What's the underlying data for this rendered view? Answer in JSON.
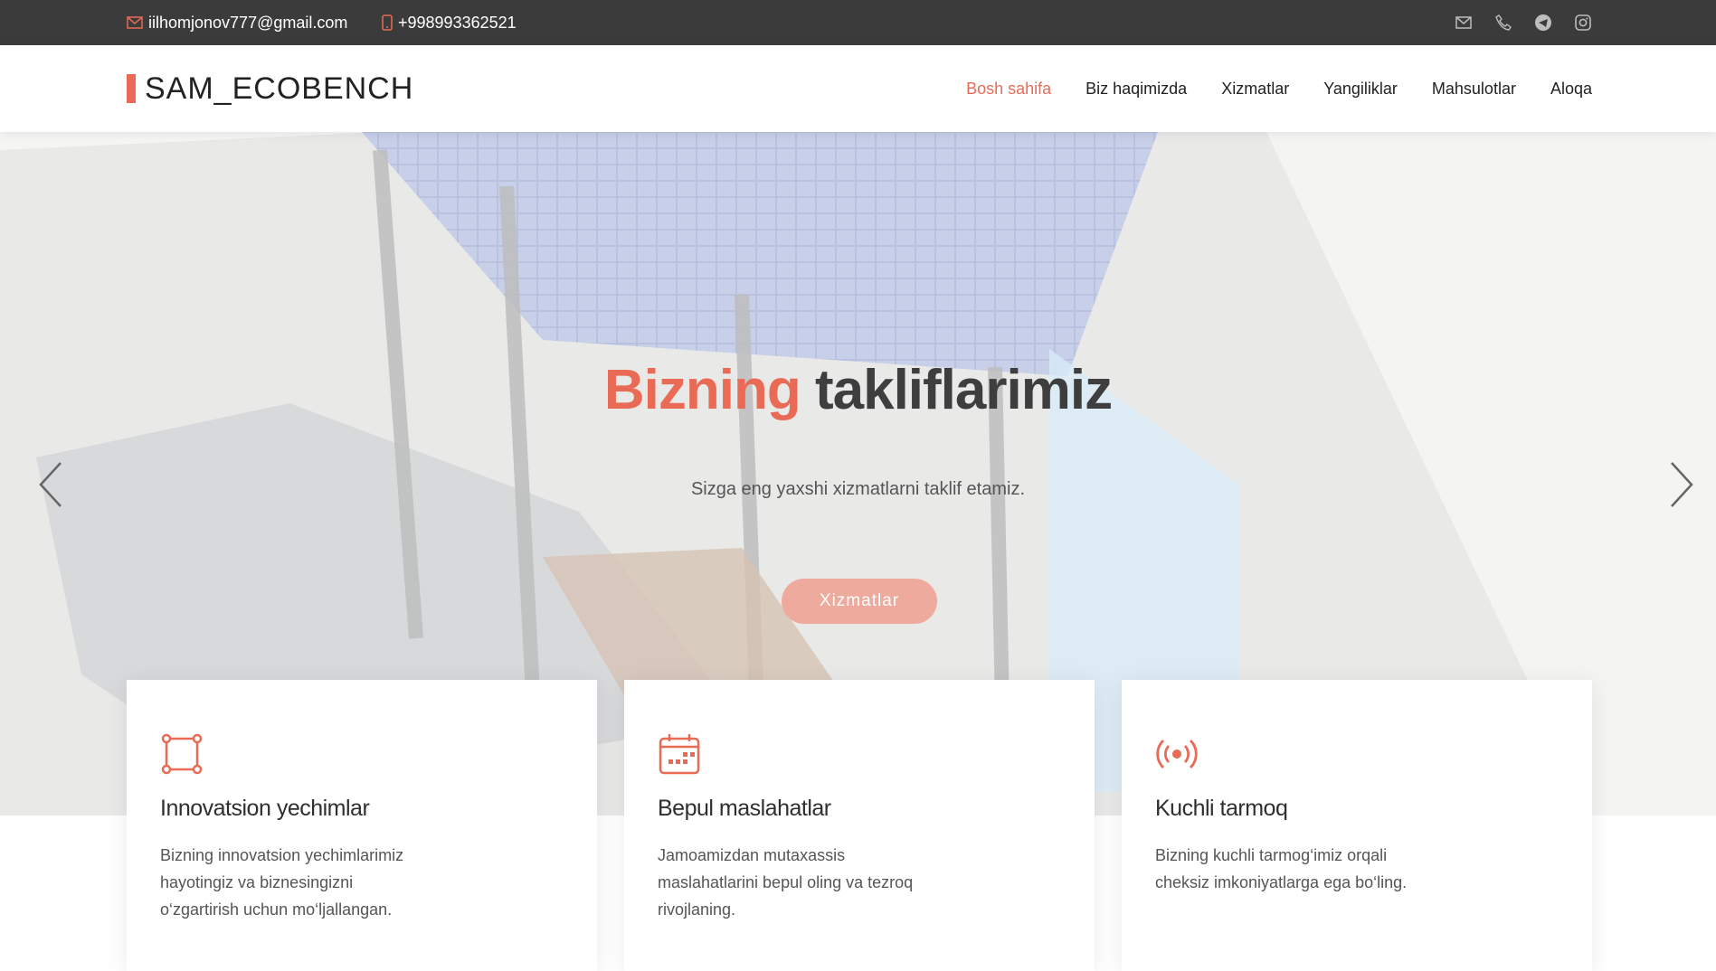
{
  "topbar": {
    "email": "iilhomjonov777@gmail.com",
    "phone": "+998993362521",
    "socials": [
      "envelope-icon",
      "phone-icon",
      "telegram-icon",
      "instagram-icon"
    ]
  },
  "header": {
    "logo": "SAM_ECOBENCH",
    "nav": [
      {
        "label": "Bosh sahifa",
        "active": true
      },
      {
        "label": "Biz haqimizda",
        "active": false
      },
      {
        "label": "Xizmatlar",
        "active": false
      },
      {
        "label": "Yangiliklar",
        "active": false
      },
      {
        "label": "Mahsulotlar",
        "active": false
      },
      {
        "label": "Aloqa",
        "active": false
      }
    ]
  },
  "hero": {
    "title_accent": "Bizning",
    "title_rest": "takliflarimiz",
    "subtitle": "Sizga eng yaxshi xizmatlarni taklif etamiz.",
    "cta": "Xizmatlar"
  },
  "features": [
    {
      "icon": "bounding-box-icon",
      "title": "Innovatsion yechimlar",
      "text": "Bizning innovatsion yechimlarimiz hayotingiz va biznesingizni o‘zgartirish uchun mo‘ljallangan."
    },
    {
      "icon": "calendar-icon",
      "title": "Bepul maslahatlar",
      "text": "Jamoamizdan mutaxassis maslahatlarini bepul oling va tezroq rivojlaning."
    },
    {
      "icon": "broadcast-icon",
      "title": "Kuchli tarmoq",
      "text": "Bizning kuchli tarmog‘imiz orqali cheksiz imkoniyatlarga ega bo‘ling."
    }
  ],
  "colors": {
    "accent": "#e96b56",
    "topbar_bg": "#3b3b3b"
  }
}
